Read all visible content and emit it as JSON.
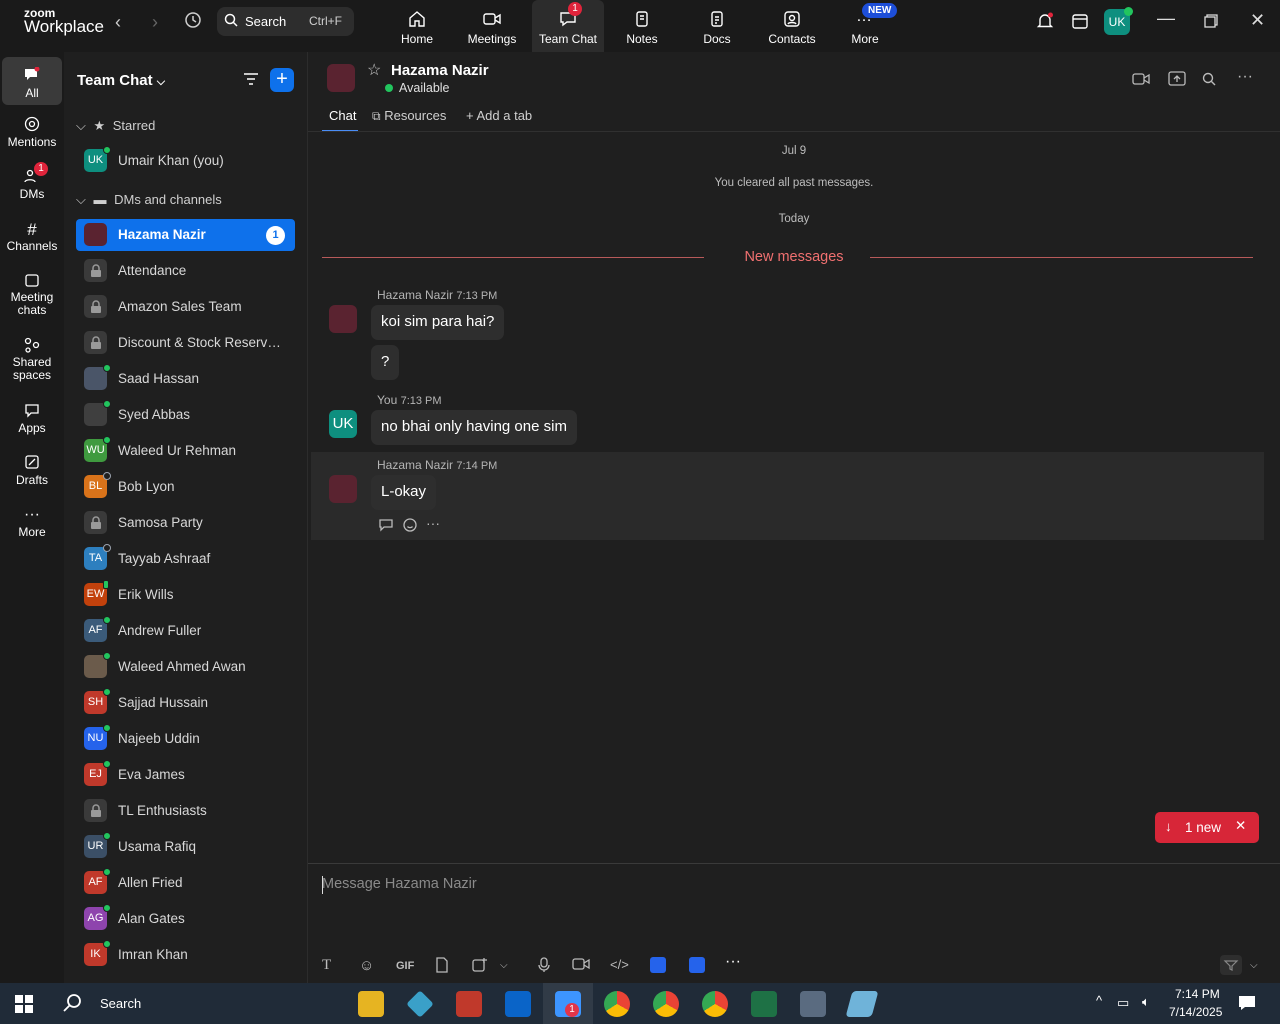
{
  "app": {
    "logo_small": "zoom",
    "logo_big": "Workplace",
    "search_label": "Search",
    "search_shortcut": "Ctrl+F",
    "nav": [
      {
        "label": "Home",
        "icon": "home-icon"
      },
      {
        "label": "Meetings",
        "icon": "video-icon"
      },
      {
        "label": "Team Chat",
        "icon": "chat-icon",
        "badge": "1",
        "active": true
      },
      {
        "label": "Notes",
        "icon": "notes-icon"
      },
      {
        "label": "Docs",
        "icon": "docs-icon"
      },
      {
        "label": "Contacts",
        "icon": "contacts-icon"
      },
      {
        "label": "More",
        "icon": "more-icon",
        "tag": "NEW"
      }
    ],
    "user_initials": "UK"
  },
  "rail": [
    {
      "label": "All",
      "icon": "chat-bubble-icon",
      "active": true
    },
    {
      "label": "Mentions",
      "icon": "at-icon"
    },
    {
      "label": "DMs",
      "icon": "people-icon",
      "badge": "1"
    },
    {
      "label": "Channels",
      "icon": "hash-icon"
    },
    {
      "label": "Meeting chats",
      "icon": "calendar-icon"
    },
    {
      "label": "Shared spaces",
      "icon": "shared-icon"
    },
    {
      "label": "Apps",
      "icon": "apps-icon"
    },
    {
      "label": "Drafts",
      "icon": "drafts-icon"
    },
    {
      "label": "More",
      "icon": "ellipsis-icon"
    }
  ],
  "sidebar": {
    "title": "Team Chat",
    "starred_label": "Starred",
    "dms_label": "DMs and channels",
    "starred": [
      {
        "name": "Umair Khan (you)",
        "initials": "UK",
        "color": "#0e8f7f",
        "presence": "online"
      }
    ],
    "items": [
      {
        "name": "Hazama Nazir",
        "kind": "photo",
        "color": "#5a2330",
        "selected": true,
        "unread": "1"
      },
      {
        "name": "Attendance",
        "kind": "lock"
      },
      {
        "name": "Amazon Sales Team",
        "kind": "lock"
      },
      {
        "name": "Discount & Stock Reservati...",
        "kind": "lock"
      },
      {
        "name": "Saad Hassan",
        "kind": "photo",
        "color": "#4a5568",
        "presence": "online"
      },
      {
        "name": "Syed Abbas",
        "kind": "photo",
        "color": "#3f3f3f",
        "presence": "online"
      },
      {
        "name": "Waleed Ur Rehman",
        "initials": "WU",
        "color": "#3f9a3f",
        "presence": "online"
      },
      {
        "name": "Bob Lyon",
        "initials": "BL",
        "color": "#d9731a",
        "presence": "offline"
      },
      {
        "name": "Samosa Party",
        "kind": "lock"
      },
      {
        "name": "Tayyab Ashraaf",
        "initials": "TA",
        "color": "#2d7fbf",
        "presence": "offline"
      },
      {
        "name": "Erik Wills",
        "initials": "EW",
        "color": "#c2410c",
        "presence": "mobile"
      },
      {
        "name": "Andrew Fuller",
        "initials": "AF",
        "color": "#3b5b7a",
        "presence": "online"
      },
      {
        "name": "Waleed Ahmed Awan",
        "kind": "photo",
        "color": "#6b5b4b",
        "presence": "online"
      },
      {
        "name": "Sajjad Hussain",
        "initials": "SH",
        "color": "#c0392b",
        "presence": "online"
      },
      {
        "name": "Najeeb Uddin",
        "initials": "NU",
        "color": "#2563eb",
        "presence": "online"
      },
      {
        "name": "Eva James",
        "initials": "EJ",
        "color": "#c0392b",
        "presence": "online"
      },
      {
        "name": "TL Enthusiasts",
        "kind": "lock"
      },
      {
        "name": "Usama Rafiq",
        "initials": "UR",
        "color": "#3b4f66",
        "presence": "online"
      },
      {
        "name": "Allen Fried",
        "initials": "AF",
        "color": "#c0392b",
        "presence": "online"
      },
      {
        "name": "Alan Gates",
        "initials": "AG",
        "color": "#8e44ad",
        "presence": "online"
      },
      {
        "name": "Imran Khan",
        "initials": "IK",
        "color": "#c0392b",
        "presence": "online"
      }
    ]
  },
  "chat": {
    "name": "Hazama Nazir",
    "status": "Available",
    "tabs": [
      "Chat",
      "Resources",
      "Add a tab"
    ],
    "date1": "Jul 9",
    "cleared": "You cleared all past messages.",
    "date2": "Today",
    "new_messages": "New messages",
    "messages": [
      {
        "sender": "Hazama Nazir",
        "time": "7:13 PM",
        "texts": [
          "koi sim para hai?",
          "?"
        ]
      },
      {
        "sender": "You",
        "time": "7:13 PM",
        "texts": [
          "no bhai only having one sim"
        ]
      },
      {
        "sender": "Hazama Nazir",
        "time": "7:14 PM",
        "texts": [
          "L-okay"
        ]
      }
    ],
    "jump_label": "1 new",
    "composer_placeholder": "Message Hazama Nazir",
    "gif_label": "GIF"
  },
  "taskbar": {
    "search": "Search",
    "time": "7:14 PM",
    "date": "7/14/2025",
    "zoom_badge": "1"
  },
  "colors": {
    "accent": "#0e71eb",
    "alert": "#d72638",
    "online": "#22c55e"
  }
}
